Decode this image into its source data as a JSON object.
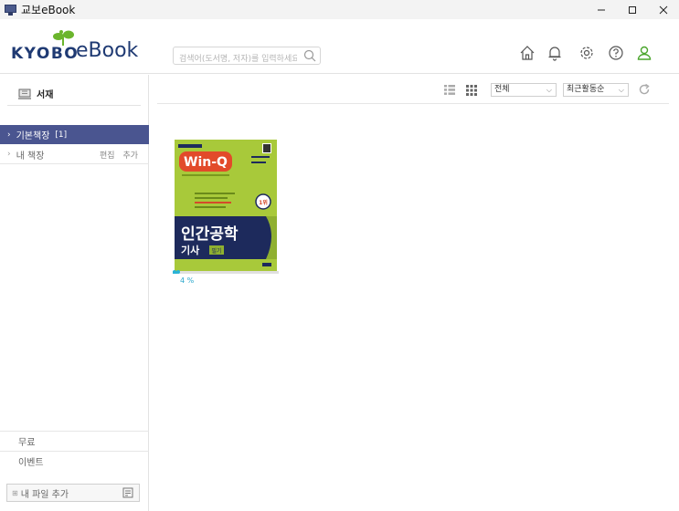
{
  "window": {
    "title": "교보eBook",
    "minimize": "—",
    "maximize": "☐",
    "close": "✕"
  },
  "logo": {
    "kyobo": "KYOBO",
    "ebook": "eBook"
  },
  "search": {
    "placeholder": "검색어(도서명, 저자)를 입력하세요."
  },
  "header_icons": [
    "home-icon",
    "bell-icon",
    "gear-icon",
    "help-icon",
    "user-icon"
  ],
  "sidebar": {
    "shelf_title": "서재",
    "basic_shelf": "기본책장",
    "basic_shelf_count": "[1]",
    "my_shelf": "내 책장",
    "edit": "편집",
    "add": "추가",
    "free": "무료",
    "event": "이벤트",
    "add_file": "내 파일 추가"
  },
  "toolbar": {
    "filter": "전체",
    "sort": "최근활동순"
  },
  "book": {
    "brand": "Win-Q",
    "title": "인간공학",
    "subtitle": "기사",
    "tag": "필기",
    "rank": "1위",
    "progress_text": "4 %",
    "progress": 0.04
  },
  "colors": {
    "accent": "#4a5590",
    "logo": "#1f3a73",
    "sprout": "#6bb52c",
    "progress": "#2bb3d6",
    "book_green": "#a8c93a",
    "book_navy": "#1d2a5c"
  }
}
